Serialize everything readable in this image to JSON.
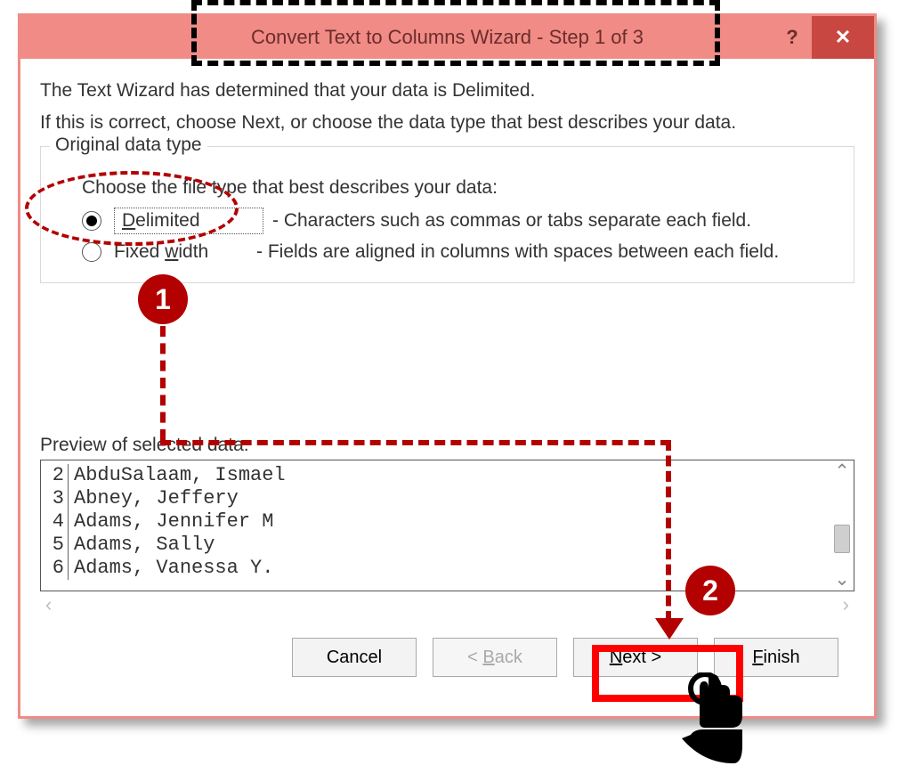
{
  "window": {
    "title": "Convert Text to Columns Wizard - Step 1 of 3",
    "help_glyph": "?",
    "close_glyph": "✕"
  },
  "intro": {
    "line1": "The Text Wizard has determined that your data is Delimited.",
    "line2": "If this is correct, choose Next, or choose the data type that best describes your data."
  },
  "group": {
    "legend": "Original data type",
    "prompt": "Choose the file type that best describes your data:",
    "options": [
      {
        "key": "delimited",
        "label_pre": "D",
        "label_rest": "elimited",
        "desc": "- Characters such as commas or tabs separate each field.",
        "checked": true
      },
      {
        "key": "fixed",
        "label_pre": "Fixed ",
        "label_ul": "w",
        "label_post": "idth",
        "desc": "- Fields are aligned in columns with spaces between each field.",
        "checked": false
      }
    ]
  },
  "preview": {
    "label": "Preview of selected data:",
    "rows": [
      {
        "n": "2",
        "t": "AbduSalaam, Ismael"
      },
      {
        "n": "3",
        "t": "Abney, Jeffery"
      },
      {
        "n": "4",
        "t": "Adams, Jennifer M"
      },
      {
        "n": "5",
        "t": "Adams, Sally"
      },
      {
        "n": "6",
        "t": "Adams, Vanessa Y."
      }
    ],
    "scroll": {
      "up": "⌃",
      "down": "⌄",
      "left": "‹",
      "right": "›"
    }
  },
  "buttons": {
    "cancel": "Cancel",
    "back_lt": "< ",
    "back_ul": "B",
    "back_rest": "ack",
    "next_ul": "N",
    "next_rest": "ext >",
    "finish_ul": "F",
    "finish_rest": "inish"
  },
  "callouts": {
    "one": "1",
    "two": "2"
  }
}
